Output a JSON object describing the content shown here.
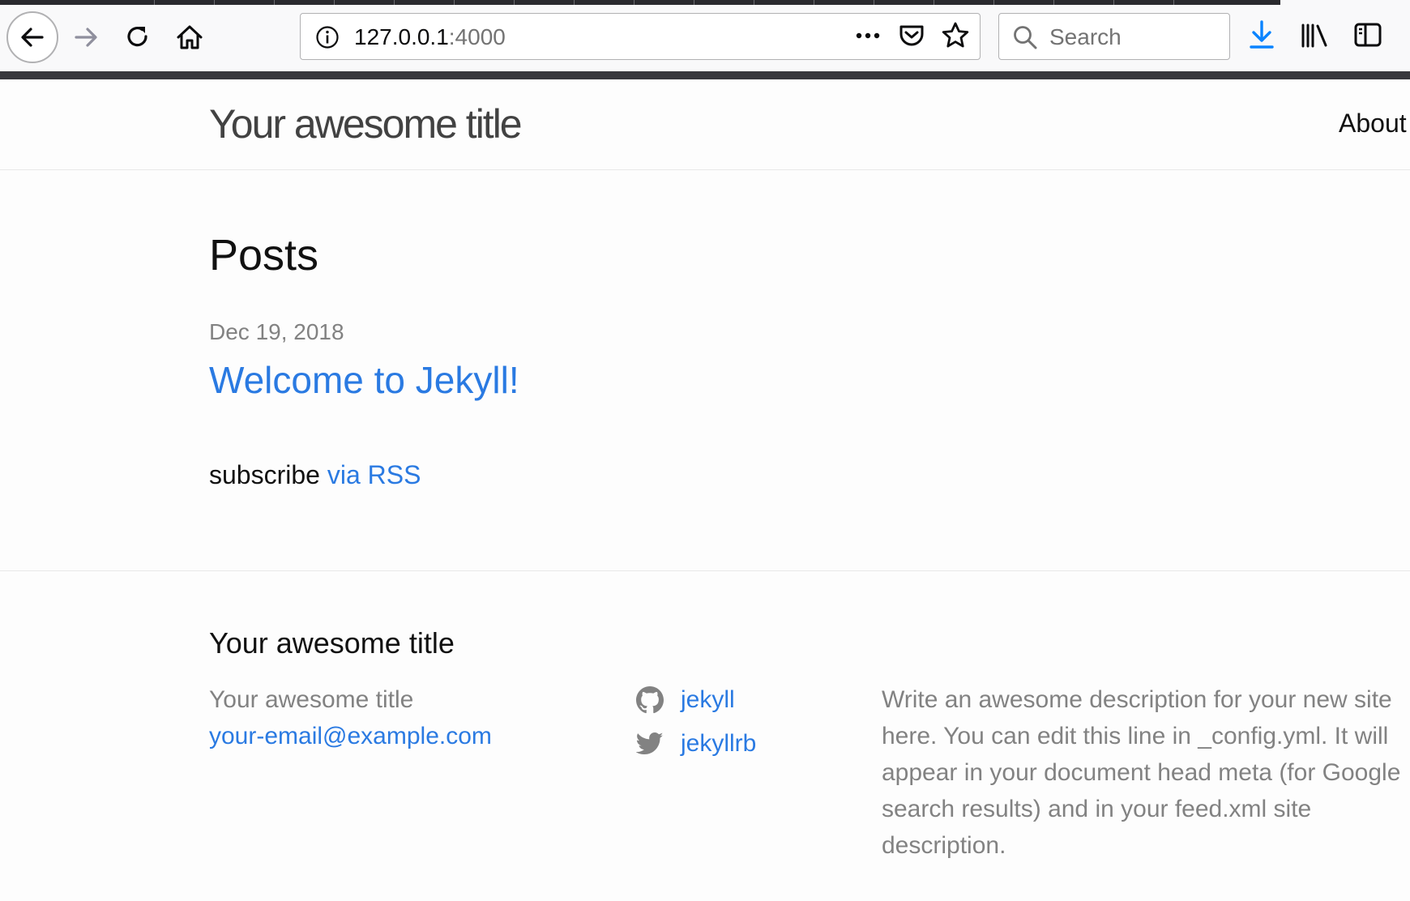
{
  "browser": {
    "url_host": "127.0.0.1",
    "url_port": ":4000",
    "search_placeholder": "Search",
    "icons": {
      "back": "back-arrow-icon",
      "forward": "forward-arrow-icon",
      "reload": "reload-icon",
      "home": "home-icon",
      "info": "info-icon",
      "page_actions": "more-actions-icon",
      "pocket": "pocket-icon",
      "bookmark": "star-icon",
      "search": "search-icon",
      "downloads": "download-icon",
      "library": "library-icon",
      "sidebar": "sidebar-icon"
    },
    "accent": "#0a84ff"
  },
  "header": {
    "site_title": "Your awesome title",
    "nav": {
      "about": "About"
    }
  },
  "main": {
    "heading": "Posts",
    "posts": [
      {
        "date": "Dec 19, 2018",
        "title": "Welcome to Jekyll!"
      }
    ],
    "rss": {
      "prefix": "subscribe",
      "link": "via RSS"
    }
  },
  "footer": {
    "heading": "Your awesome title",
    "name": "Your awesome title",
    "email": "your-email@example.com",
    "social": {
      "github_username": "jekyll",
      "twitter_username": "jekyllrb"
    },
    "description": "Write an awesome description for your new site here. You can edit this line in _config.yml. It will appear in your document head meta (for Google search results) and in your feed.xml site description."
  },
  "colors": {
    "link": "#2a7ae2",
    "text": "#111111",
    "muted": "#828282",
    "border": "#e8e8e8",
    "background": "#fdfdfd"
  }
}
